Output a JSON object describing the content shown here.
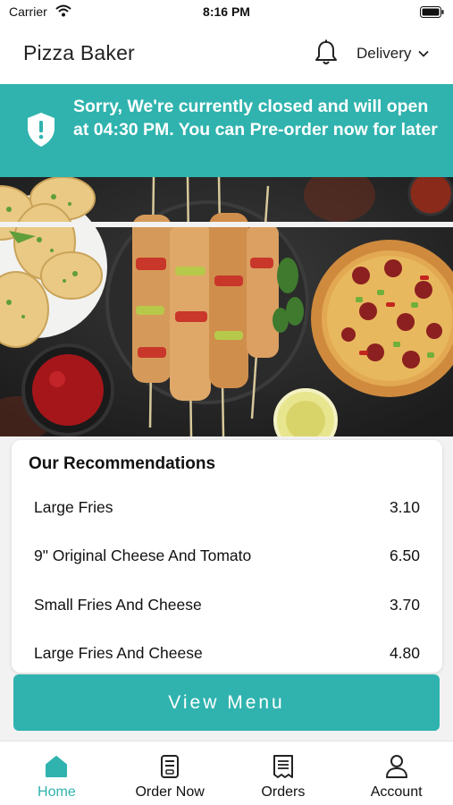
{
  "status": {
    "carrier": "Carrier",
    "time": "8:16 PM"
  },
  "header": {
    "title": "Pizza Baker",
    "delivery_label": "Delivery"
  },
  "banner": {
    "message": "Sorry, We're currently closed and will open at 04:30 PM. You can Pre-order now for later"
  },
  "recommendations": {
    "title": "Our Recommendations",
    "items": [
      {
        "name": "Large Fries",
        "price": "3.10"
      },
      {
        "name": "9\" Original Cheese And Tomato",
        "price": "6.50"
      },
      {
        "name": "Small Fries And Cheese",
        "price": "3.70"
      },
      {
        "name": "Large Fries And Cheese",
        "price": "4.80"
      }
    ]
  },
  "actions": {
    "view_menu": "View Menu"
  },
  "tabs": [
    {
      "label": "Home",
      "icon": "home-icon",
      "active": true
    },
    {
      "label": "Order Now",
      "icon": "order-icon",
      "active": false
    },
    {
      "label": "Orders",
      "icon": "receipt-icon",
      "active": false
    },
    {
      "label": "Account",
      "icon": "person-icon",
      "active": false
    }
  ],
  "colors": {
    "accent": "#30b3ae",
    "text": "#111111",
    "background": "#f2f2f2"
  }
}
